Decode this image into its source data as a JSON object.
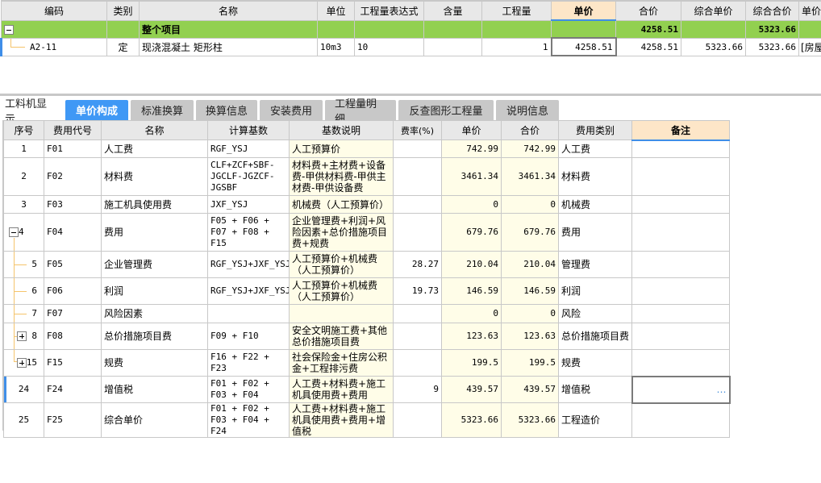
{
  "top_grid": {
    "columns": [
      "编码",
      "类别",
      "名称",
      "单位",
      "工程量表达式",
      "含量",
      "工程量",
      "单价",
      "合价",
      "综合单价",
      "综合合价",
      "单价"
    ],
    "active_column": "单价",
    "group_row": {
      "name": "整个项目",
      "total_price": "4258.51",
      "composite_total": "5323.66",
      "expanded": true
    },
    "rows": [
      {
        "code": "A2-11",
        "type": "定",
        "name": "现浇混凝土 矩形柱",
        "unit": "10m3",
        "quantity_expr": "10",
        "content": "",
        "quantity": "1",
        "unit_price": "4258.51",
        "total_price": "4258.51",
        "composite_unit_price": "5323.66",
        "composite_total": "5323.66",
        "extra": "[房屋"
      }
    ]
  },
  "tabs": [
    "工料机显示",
    "单价构成",
    "标准换算",
    "换算信息",
    "安装费用",
    "工程量明细",
    "反查图形工程量",
    "说明信息"
  ],
  "active_tab": "单价构成",
  "bottom_grid": {
    "columns": [
      "序号",
      "费用代号",
      "名称",
      "计算基数",
      "基数说明",
      "费率(%)",
      "单价",
      "合价",
      "费用类别",
      "备注"
    ],
    "active_column": "备注",
    "rows": [
      {
        "seq": "1",
        "code": "F01",
        "name": "人工费",
        "base": "RGF_YSJ",
        "base_desc": "人工预算价",
        "rate": "",
        "unit_price": "742.99",
        "total": "742.99",
        "category": "人工费",
        "note": ""
      },
      {
        "seq": "2",
        "code": "F02",
        "name": "材料费",
        "base": "CLF+ZCF+SBF-JGCLF-JGZCF-JGSBF",
        "base_desc": "材料费+主材费+设备费-甲供材料费-甲供主材费-甲供设备费",
        "rate": "",
        "unit_price": "3461.34",
        "total": "3461.34",
        "category": "材料费",
        "note": ""
      },
      {
        "seq": "3",
        "code": "F03",
        "name": "施工机具使用费",
        "base": "JXF_YSJ",
        "base_desc": "机械费（人工预算价）",
        "rate": "",
        "unit_price": "0",
        "total": "0",
        "category": "机械费",
        "note": ""
      },
      {
        "seq": "4",
        "code": "F04",
        "name": "费用",
        "base": "F05 + F06 + F07 + F08 + F15",
        "base_desc": "企业管理费+利润+风险因素+总价措施项目费+规费",
        "rate": "",
        "unit_price": "679.76",
        "total": "679.76",
        "category": "费用",
        "note": ""
      },
      {
        "seq": "5",
        "code": "F05",
        "name": "企业管理费",
        "base": "RGF_YSJ+JXF_YSJ",
        "base_desc": "人工预算价+机械费（人工预算价）",
        "rate": "28.27",
        "unit_price": "210.04",
        "total": "210.04",
        "category": "管理费",
        "note": ""
      },
      {
        "seq": "6",
        "code": "F06",
        "name": "利润",
        "base": "RGF_YSJ+JXF_YSJ",
        "base_desc": "人工预算价+机械费（人工预算价）",
        "rate": "19.73",
        "unit_price": "146.59",
        "total": "146.59",
        "category": "利润",
        "note": ""
      },
      {
        "seq": "7",
        "code": "F07",
        "name": "风险因素",
        "base": "",
        "base_desc": "",
        "rate": "",
        "unit_price": "0",
        "total": "0",
        "category": "风险",
        "note": ""
      },
      {
        "seq": "8",
        "code": "F08",
        "name": "总价措施项目费",
        "base": "F09 + F10",
        "base_desc": "安全文明施工费+其他总价措施项目费",
        "rate": "",
        "unit_price": "123.63",
        "total": "123.63",
        "category": "总价措施项目费",
        "note": ""
      },
      {
        "seq": "15",
        "code": "F15",
        "name": "规费",
        "base": "F16 + F22 + F23",
        "base_desc": "社会保险金+住房公积金+工程排污费",
        "rate": "",
        "unit_price": "199.5",
        "total": "199.5",
        "category": "规费",
        "note": ""
      },
      {
        "seq": "24",
        "code": "F24",
        "name": "增值税",
        "base": "F01 + F02 + F03 + F04",
        "base_desc": "人工费+材料费+施工机具使用费+费用",
        "rate": "9",
        "unit_price": "439.57",
        "total": "439.57",
        "category": "增值税",
        "note": "…"
      },
      {
        "seq": "25",
        "code": "F25",
        "name": "综合单价",
        "base": "F01 + F02 + F03 + F04 + F24",
        "base_desc": "人工费+材料费+施工机具使用费+费用+增值税",
        "rate": "",
        "unit_price": "5323.66",
        "total": "5323.66",
        "category": "工程造价",
        "note": ""
      }
    ]
  },
  "colors": {
    "group_row_bg": "#92d050",
    "active_header_bg": "#fde6c8",
    "active_tab_bg": "#3f98f5",
    "tree_line": "#f5c46b",
    "yellow_cell_bg": "#fffde8",
    "selection_accent": "#3f8ee8"
  }
}
